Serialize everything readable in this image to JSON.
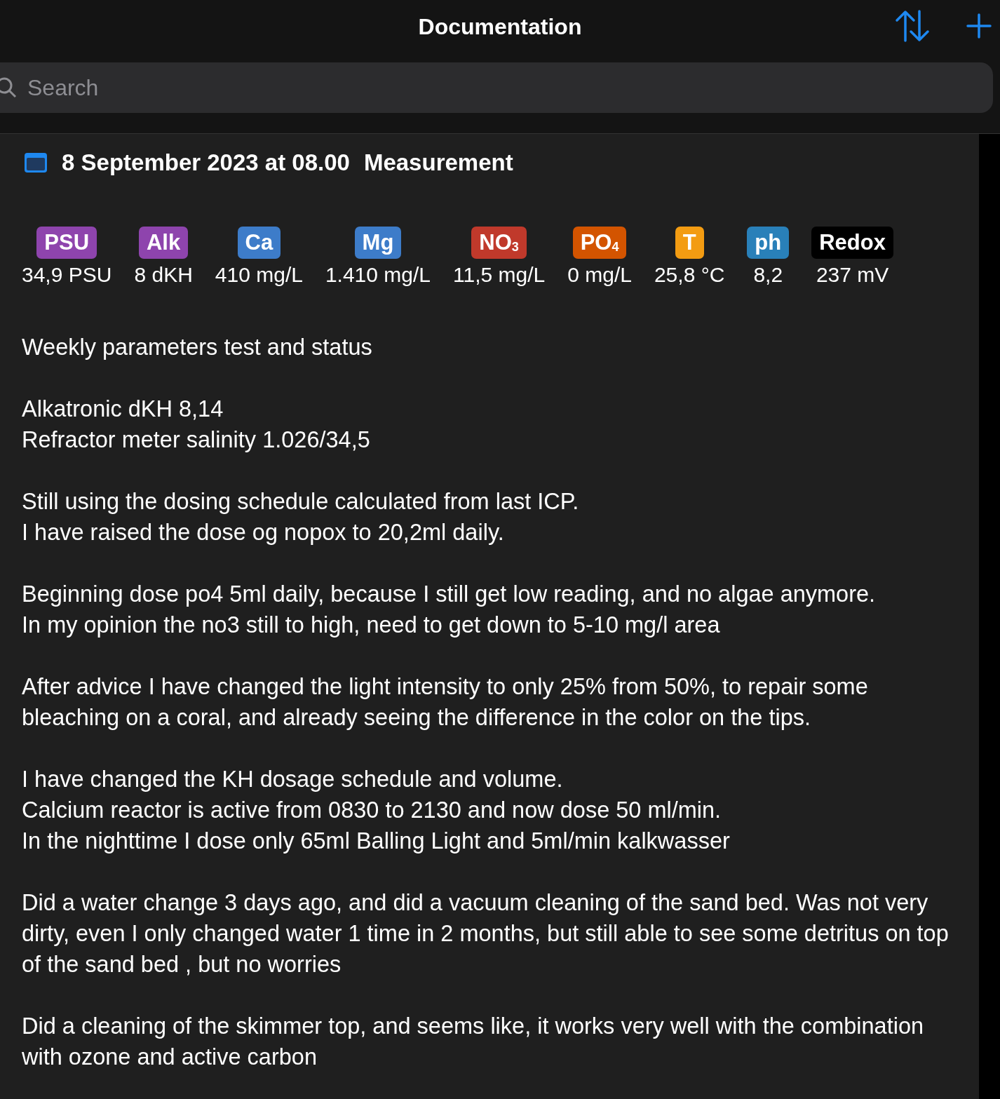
{
  "navigation": {
    "title": "Documentation"
  },
  "search": {
    "placeholder": "Search"
  },
  "entry": {
    "date": "8 September 2023 at 08.00",
    "type": "Measurement",
    "parameters": [
      {
        "label": "PSU",
        "color": "#8e44ad",
        "value": "34,9 PSU"
      },
      {
        "label": "Alk",
        "color": "#8e44ad",
        "value": "8 dKH"
      },
      {
        "label": "Ca",
        "color": "#3d7cc9",
        "value": "410 mg/L"
      },
      {
        "label": "Mg",
        "color": "#3d7cc9",
        "value": "1.410 mg/L"
      },
      {
        "label": "NO$_{3}$",
        "color": "#c0392b",
        "value": "11,5 mg/L"
      },
      {
        "label": "PO$_{4}$",
        "color": "#d35400",
        "value": "0 mg/L"
      },
      {
        "label": "T",
        "color": "#f39c12",
        "value": "25,8 °C"
      },
      {
        "label": "ph",
        "color": "#2980b9",
        "value": "8,2"
      },
      {
        "label": "Redox",
        "color": "#000000",
        "value": "237 mV"
      }
    ],
    "notes": [
      [
        "Weekly parameters test and status"
      ],
      [
        "Alkatronic dKH 8,14",
        "Refractor meter salinity 1.026/34,5"
      ],
      [
        "Still using the dosing schedule calculated from last ICP.",
        "I have raised the dose og nopox to 20,2ml daily."
      ],
      [
        "Beginning dose po4 5ml daily, because I still get low reading, and no algae anymore.",
        "In my opinion the no3 still to high, need to get down to 5-10 mg/l area"
      ],
      [
        "After advice I have changed the light intensity to only 25% from 50%, to repair some bleaching on a coral, and already seeing the difference in the color on the tips."
      ],
      [
        "I have changed the KH dosage schedule and volume.",
        "Calcium reactor is active from 0830 to 2130 and now dose 50 ml/min.",
        "In the nighttime I dose only 65ml Balling Light and 5ml/min kalkwasser"
      ],
      [
        "Did a water change 3 days ago, and did a vacuum cleaning of the sand bed. Was not very dirty, even I only changed water 1 time in 2 months, but still able to see some detritus on top of the sand bed , but no worries"
      ],
      [
        "Did a cleaning of the skimmer top, and seems like, it works very well with the combination with ozone and active carbon"
      ]
    ]
  }
}
